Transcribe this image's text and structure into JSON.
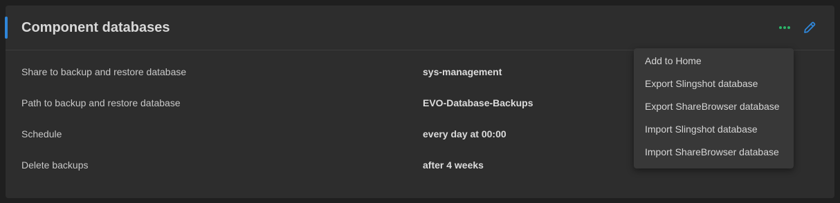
{
  "card": {
    "title": "Component databases",
    "accent_color": "#2f86d9",
    "actions": {
      "more_icon": "more-dots-icon",
      "more_color": "#2db56a",
      "edit_icon": "pencil-icon",
      "edit_color": "#2f86d9"
    },
    "rows": [
      {
        "label": "Share to backup and restore database",
        "value": "sys-management"
      },
      {
        "label": "Path to backup and restore database",
        "value": "EVO-Database-Backups"
      },
      {
        "label": "Schedule",
        "value": "every day at 00:00"
      },
      {
        "label": "Delete backups",
        "value": "after 4 weeks"
      }
    ]
  },
  "menu": {
    "items": [
      {
        "label": "Add to Home"
      },
      {
        "label": "Export Slingshot database"
      },
      {
        "label": "Export ShareBrowser database"
      },
      {
        "label": "Import Slingshot database"
      },
      {
        "label": "Import ShareBrowser database"
      }
    ]
  }
}
